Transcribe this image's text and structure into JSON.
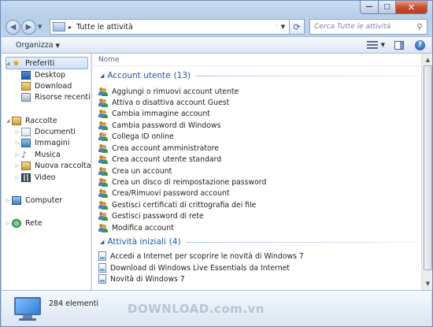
{
  "window": {
    "min_glyph": "—",
    "max_glyph": "□",
    "close_glyph": "✕"
  },
  "address": {
    "path": "Tutte le attività",
    "separator": "▸",
    "search_placeholder": "Cerca Tutte le attività"
  },
  "toolbar": {
    "organize_label": "Organizza"
  },
  "sidebar": {
    "favorites": "Preferiti",
    "favorites_items": [
      "Desktop",
      "Download",
      "Risorse recenti"
    ],
    "libraries": "Raccolte",
    "library_items": [
      "Documenti",
      "Immagini",
      "Musica",
      "Nuova raccolta",
      "Video"
    ],
    "computer": "Computer",
    "network": "Rete"
  },
  "content": {
    "column_header": "Nome",
    "groups": [
      {
        "title": "Account utente",
        "count": "(13)",
        "items": [
          "Aggiungi o rimuovi account utente",
          "Attiva o disattiva account Guest",
          "Cambia immagine account",
          "Cambia password di Windows",
          "Collega ID online",
          "Crea account amministratore",
          "Crea account utente standard",
          "Crea un account",
          "Crea un disco di reimpostazione password",
          "Crea/Rimuovi password account",
          "Gestisci certificati di crittografia dei file",
          "Gestisci password di rete",
          "Modifica account"
        ]
      },
      {
        "title": "Attività iniziali",
        "count": "(4)",
        "items": [
          "Accedi a Internet per scoprire le novità di Windows 7",
          "Download di Windows Live Essentials da Internet",
          "Novità di Windows 7"
        ]
      }
    ]
  },
  "details": {
    "item_count": "284 elementi"
  },
  "watermark": "DOWNLOAD.com.vn",
  "colors": {
    "group_title": "#1d58b8",
    "selection": "#cfe2f8",
    "window_frame": "#bed4ee"
  }
}
